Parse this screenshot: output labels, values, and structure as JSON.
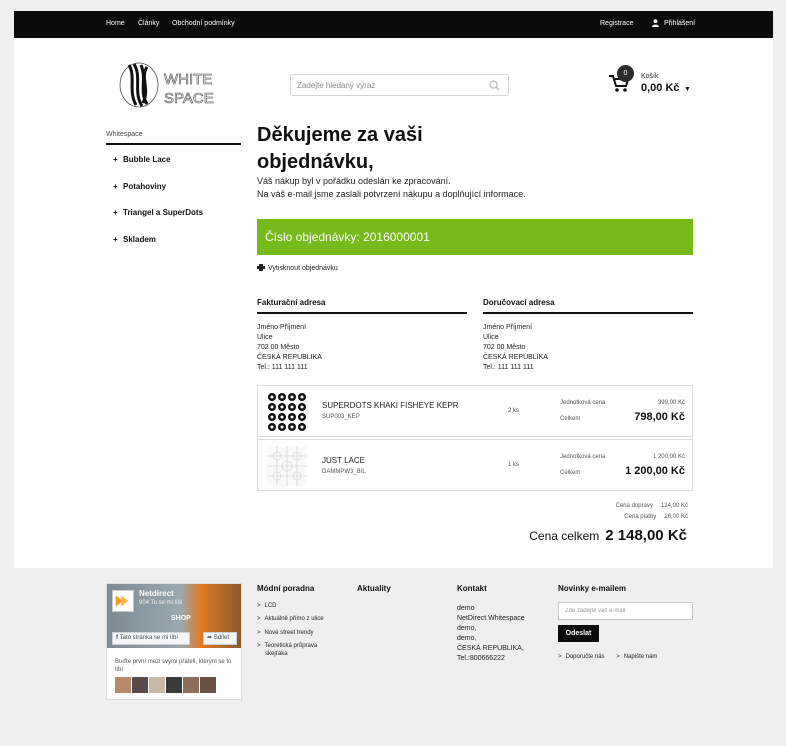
{
  "topbar": {
    "nav": [
      "Home",
      "Články",
      "Obchodní podmínky"
    ],
    "register": "Registrace",
    "login": "Přihlášení"
  },
  "header": {
    "logo_text": [
      "WHITE",
      "SPACE"
    ],
    "search_placeholder": "Zadejte hledaný výraz",
    "cart": {
      "count": "0",
      "label": "Košík",
      "total": "0,00 Kč"
    }
  },
  "sidebar": {
    "title": "Whitespace",
    "items": [
      "Bubble Lace",
      "Potahoviny",
      "Triangel a SuperDots",
      "Skladem"
    ]
  },
  "thanks": {
    "title": "Děkujeme za vaši objednávku,",
    "lines": [
      "Váš nákup byl v pořádku odeslán ke zpracování.",
      "Na váš e-mail jsme zaslali potvrzení nákupu a doplňující informace."
    ]
  },
  "order": {
    "label": "Číslo objednávky: 2016000001"
  },
  "print_label": "Vytisknout objednávku",
  "billing": {
    "title": "Fakturační adresa",
    "lines": [
      "Jméno Příjmení",
      "Ulice",
      "702 00 Město",
      "ČESKÁ REPUBLIKA",
      "Tel.: 111 111 111"
    ]
  },
  "delivery": {
    "title": "Doručovací adresa",
    "lines": [
      "Jméno Příjmení",
      "Ulice",
      "702 00 Město",
      "ČESKÁ REPUBLIKA",
      "Tel.: 111 111 111"
    ]
  },
  "products": [
    {
      "name": "SUPERDOTS KHAKI FISHEYE KEPR",
      "code": "SUP003_KEP",
      "qty": "2 ks",
      "unit_label": "Jednotková cena",
      "unit_price": "399,00 Kč",
      "total_label": "Celkem",
      "total_price": "798,00 Kč"
    },
    {
      "name": "JUST LACE",
      "code": "DAMMPW3_BIL",
      "qty": "1 ks",
      "unit_label": "Jednotková cena",
      "unit_price": "1 200,00 Kč",
      "total_label": "Celkem",
      "total_price": "1 200,00 Kč"
    }
  ],
  "fees": [
    {
      "label": "Cena dopravy",
      "value": "124,00 Kč"
    },
    {
      "label": "Cena platby",
      "value": "26,00 Kč"
    }
  ],
  "grand_total": {
    "label": "Cena celkem",
    "value": "2 148,00 Kč"
  },
  "footer": {
    "facebook": {
      "name": "Netdirect",
      "likes": "904 To se mi líbí",
      "shop": "SHOP",
      "like_button": "Tato stránka se mi líbí",
      "share_button": "Sdílet",
      "friends_text": "Buďte první mezi svými přáteli, kterým se to líbí"
    },
    "fashion": {
      "title": "Módní poradna",
      "links": [
        "LCD",
        "Aktuálně přímo z ulice",
        "Nové street trendy",
        "Teoretická průprava",
        "skejťáka"
      ]
    },
    "news": {
      "title": "Aktuality"
    },
    "contact": {
      "title": "Kontakt",
      "lines": [
        "demo",
        "NetDirect Whitespace",
        "demo,",
        "demo,",
        "ČESKÁ REPUBLIKA,",
        "Tel.:800666222"
      ]
    },
    "newsletter": {
      "title": "Novinky e-mailem",
      "placeholder": "Zde zadejte váš e-mail",
      "button": "Odeslat",
      "links": [
        "Doporučte nás",
        "Napište nám"
      ]
    }
  },
  "colors": {
    "accent_green": "#75b91b",
    "topbar": "#0b0b0b"
  }
}
